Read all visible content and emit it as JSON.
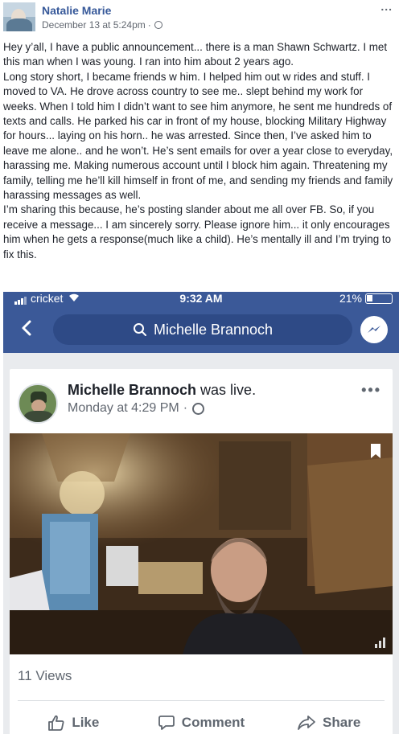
{
  "post": {
    "author": "Natalie Marie",
    "date": "December 13 at 5:24pm",
    "separator": "·",
    "more": "...",
    "text": "Hey y’all, I have a public announcement... there is a man Shawn Schwartz. I met this man when I was young. I ran into him about 2 years ago.\nLong story short, I became friends w him. I helped him out w rides and stuff. I moved to VA. He drove across country to see me.. slept behind my work for weeks. When I told him I didn’t want to see him anymore, he sent me hundreds of texts and calls. He parked his car in front of my house, blocking Military Highway for hours... laying on his horn.. he was arrested. Since then, I’ve asked him to leave me alone.. and he won’t. He’s sent emails for over a year close to everyday, harassing me. Making numerous account until I block him again. Threatening my family, telling me he’ll kill himself in front of me, and sending my friends and family harassing messages as well.\nI’m sharing this because, he’s posting slander about me all over FB. So, if you receive a message... I am sincerely sorry. Please ignore him... it only encourages him when he gets a response(much like a child). He’s mentally ill and I’m trying to fix this."
  },
  "screenshot": {
    "status": {
      "carrier": "cricket",
      "time": "9:32 AM",
      "battery": "21%"
    },
    "search": {
      "query": "Michelle Brannoch"
    },
    "card": {
      "name": "Michelle Brannoch",
      "action": "was live.",
      "meta": "Monday at 4:29 PM",
      "separator": "·",
      "more": "•••",
      "views": "11 Views",
      "actions": {
        "like": "Like",
        "comment": "Comment",
        "share": "Share"
      }
    }
  },
  "colors": {
    "fb_blue": "#3b5998",
    "link": "#365899",
    "secondary": "#606770"
  }
}
